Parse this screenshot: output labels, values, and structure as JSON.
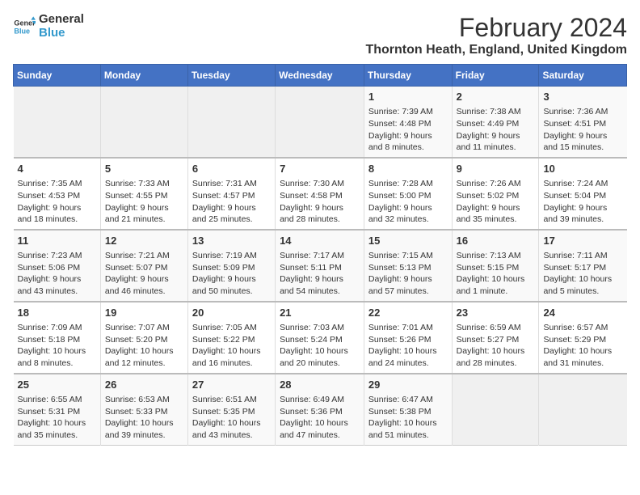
{
  "logo": {
    "line1": "General",
    "line2": "Blue"
  },
  "title": "February 2024",
  "subtitle": "Thornton Heath, England, United Kingdom",
  "headers": [
    "Sunday",
    "Monday",
    "Tuesday",
    "Wednesday",
    "Thursday",
    "Friday",
    "Saturday"
  ],
  "weeks": [
    [
      {
        "day": "",
        "content": ""
      },
      {
        "day": "",
        "content": ""
      },
      {
        "day": "",
        "content": ""
      },
      {
        "day": "",
        "content": ""
      },
      {
        "day": "1",
        "content": "Sunrise: 7:39 AM\nSunset: 4:48 PM\nDaylight: 9 hours\nand 8 minutes."
      },
      {
        "day": "2",
        "content": "Sunrise: 7:38 AM\nSunset: 4:49 PM\nDaylight: 9 hours\nand 11 minutes."
      },
      {
        "day": "3",
        "content": "Sunrise: 7:36 AM\nSunset: 4:51 PM\nDaylight: 9 hours\nand 15 minutes."
      }
    ],
    [
      {
        "day": "4",
        "content": "Sunrise: 7:35 AM\nSunset: 4:53 PM\nDaylight: 9 hours\nand 18 minutes."
      },
      {
        "day": "5",
        "content": "Sunrise: 7:33 AM\nSunset: 4:55 PM\nDaylight: 9 hours\nand 21 minutes."
      },
      {
        "day": "6",
        "content": "Sunrise: 7:31 AM\nSunset: 4:57 PM\nDaylight: 9 hours\nand 25 minutes."
      },
      {
        "day": "7",
        "content": "Sunrise: 7:30 AM\nSunset: 4:58 PM\nDaylight: 9 hours\nand 28 minutes."
      },
      {
        "day": "8",
        "content": "Sunrise: 7:28 AM\nSunset: 5:00 PM\nDaylight: 9 hours\nand 32 minutes."
      },
      {
        "day": "9",
        "content": "Sunrise: 7:26 AM\nSunset: 5:02 PM\nDaylight: 9 hours\nand 35 minutes."
      },
      {
        "day": "10",
        "content": "Sunrise: 7:24 AM\nSunset: 5:04 PM\nDaylight: 9 hours\nand 39 minutes."
      }
    ],
    [
      {
        "day": "11",
        "content": "Sunrise: 7:23 AM\nSunset: 5:06 PM\nDaylight: 9 hours\nand 43 minutes."
      },
      {
        "day": "12",
        "content": "Sunrise: 7:21 AM\nSunset: 5:07 PM\nDaylight: 9 hours\nand 46 minutes."
      },
      {
        "day": "13",
        "content": "Sunrise: 7:19 AM\nSunset: 5:09 PM\nDaylight: 9 hours\nand 50 minutes."
      },
      {
        "day": "14",
        "content": "Sunrise: 7:17 AM\nSunset: 5:11 PM\nDaylight: 9 hours\nand 54 minutes."
      },
      {
        "day": "15",
        "content": "Sunrise: 7:15 AM\nSunset: 5:13 PM\nDaylight: 9 hours\nand 57 minutes."
      },
      {
        "day": "16",
        "content": "Sunrise: 7:13 AM\nSunset: 5:15 PM\nDaylight: 10 hours\nand 1 minute."
      },
      {
        "day": "17",
        "content": "Sunrise: 7:11 AM\nSunset: 5:17 PM\nDaylight: 10 hours\nand 5 minutes."
      }
    ],
    [
      {
        "day": "18",
        "content": "Sunrise: 7:09 AM\nSunset: 5:18 PM\nDaylight: 10 hours\nand 8 minutes."
      },
      {
        "day": "19",
        "content": "Sunrise: 7:07 AM\nSunset: 5:20 PM\nDaylight: 10 hours\nand 12 minutes."
      },
      {
        "day": "20",
        "content": "Sunrise: 7:05 AM\nSunset: 5:22 PM\nDaylight: 10 hours\nand 16 minutes."
      },
      {
        "day": "21",
        "content": "Sunrise: 7:03 AM\nSunset: 5:24 PM\nDaylight: 10 hours\nand 20 minutes."
      },
      {
        "day": "22",
        "content": "Sunrise: 7:01 AM\nSunset: 5:26 PM\nDaylight: 10 hours\nand 24 minutes."
      },
      {
        "day": "23",
        "content": "Sunrise: 6:59 AM\nSunset: 5:27 PM\nDaylight: 10 hours\nand 28 minutes."
      },
      {
        "day": "24",
        "content": "Sunrise: 6:57 AM\nSunset: 5:29 PM\nDaylight: 10 hours\nand 31 minutes."
      }
    ],
    [
      {
        "day": "25",
        "content": "Sunrise: 6:55 AM\nSunset: 5:31 PM\nDaylight: 10 hours\nand 35 minutes."
      },
      {
        "day": "26",
        "content": "Sunrise: 6:53 AM\nSunset: 5:33 PM\nDaylight: 10 hours\nand 39 minutes."
      },
      {
        "day": "27",
        "content": "Sunrise: 6:51 AM\nSunset: 5:35 PM\nDaylight: 10 hours\nand 43 minutes."
      },
      {
        "day": "28",
        "content": "Sunrise: 6:49 AM\nSunset: 5:36 PM\nDaylight: 10 hours\nand 47 minutes."
      },
      {
        "day": "29",
        "content": "Sunrise: 6:47 AM\nSunset: 5:38 PM\nDaylight: 10 hours\nand 51 minutes."
      },
      {
        "day": "",
        "content": ""
      },
      {
        "day": "",
        "content": ""
      }
    ]
  ]
}
